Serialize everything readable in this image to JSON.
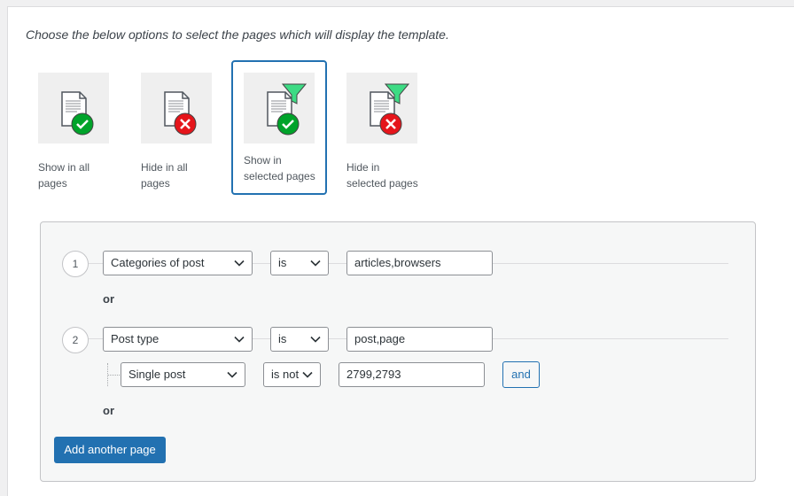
{
  "intro": "Choose the below options to select the pages which will display the template.",
  "options": [
    {
      "line1": "Show in all",
      "line2": "pages",
      "icon": "document-check-icon",
      "selected": false
    },
    {
      "line1": "Hide in all",
      "line2": "pages",
      "icon": "document-cross-icon",
      "selected": false
    },
    {
      "line1": "Show in",
      "line2": "selected pages",
      "icon": "document-filter-check-icon",
      "selected": true
    },
    {
      "line1": "Hide in",
      "line2": "selected pages",
      "icon": "document-filter-cross-icon",
      "selected": false
    }
  ],
  "rules": [
    {
      "number": "1",
      "field": "Categories of post",
      "operator": "is",
      "value": "articles,browsers"
    },
    {
      "number": "2",
      "field": "Post type",
      "operator": "is",
      "value": "post,page",
      "sub": {
        "field": "Single post",
        "operator": "is not",
        "value": "2799,2793",
        "and_label": "and"
      }
    }
  ],
  "or_label": "or",
  "add_button": "Add another page",
  "colors": {
    "accent": "#2271b1",
    "check": "#00a32a",
    "cross": "#e5151b",
    "filter": "#3ddb84"
  }
}
